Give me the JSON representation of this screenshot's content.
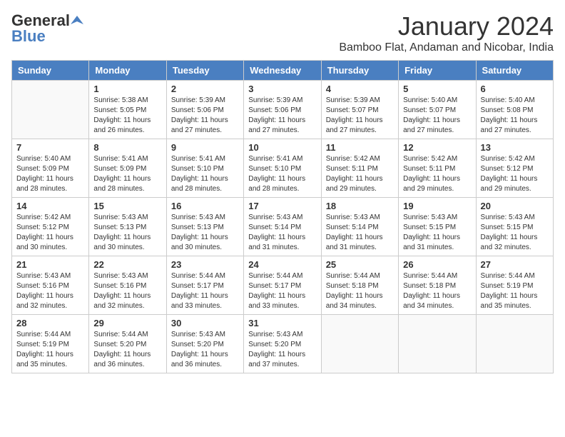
{
  "logo": {
    "general": "General",
    "blue": "Blue"
  },
  "header": {
    "month": "January 2024",
    "location": "Bamboo Flat, Andaman and Nicobar, India"
  },
  "days_of_week": [
    "Sunday",
    "Monday",
    "Tuesday",
    "Wednesday",
    "Thursday",
    "Friday",
    "Saturday"
  ],
  "weeks": [
    [
      {
        "day": "",
        "sunrise": "",
        "sunset": "",
        "daylight": ""
      },
      {
        "day": "1",
        "sunrise": "Sunrise: 5:38 AM",
        "sunset": "Sunset: 5:05 PM",
        "daylight": "Daylight: 11 hours and 26 minutes."
      },
      {
        "day": "2",
        "sunrise": "Sunrise: 5:39 AM",
        "sunset": "Sunset: 5:06 PM",
        "daylight": "Daylight: 11 hours and 27 minutes."
      },
      {
        "day": "3",
        "sunrise": "Sunrise: 5:39 AM",
        "sunset": "Sunset: 5:06 PM",
        "daylight": "Daylight: 11 hours and 27 minutes."
      },
      {
        "day": "4",
        "sunrise": "Sunrise: 5:39 AM",
        "sunset": "Sunset: 5:07 PM",
        "daylight": "Daylight: 11 hours and 27 minutes."
      },
      {
        "day": "5",
        "sunrise": "Sunrise: 5:40 AM",
        "sunset": "Sunset: 5:07 PM",
        "daylight": "Daylight: 11 hours and 27 minutes."
      },
      {
        "day": "6",
        "sunrise": "Sunrise: 5:40 AM",
        "sunset": "Sunset: 5:08 PM",
        "daylight": "Daylight: 11 hours and 27 minutes."
      }
    ],
    [
      {
        "day": "7",
        "sunrise": "Sunrise: 5:40 AM",
        "sunset": "Sunset: 5:09 PM",
        "daylight": "Daylight: 11 hours and 28 minutes."
      },
      {
        "day": "8",
        "sunrise": "Sunrise: 5:41 AM",
        "sunset": "Sunset: 5:09 PM",
        "daylight": "Daylight: 11 hours and 28 minutes."
      },
      {
        "day": "9",
        "sunrise": "Sunrise: 5:41 AM",
        "sunset": "Sunset: 5:10 PM",
        "daylight": "Daylight: 11 hours and 28 minutes."
      },
      {
        "day": "10",
        "sunrise": "Sunrise: 5:41 AM",
        "sunset": "Sunset: 5:10 PM",
        "daylight": "Daylight: 11 hours and 28 minutes."
      },
      {
        "day": "11",
        "sunrise": "Sunrise: 5:42 AM",
        "sunset": "Sunset: 5:11 PM",
        "daylight": "Daylight: 11 hours and 29 minutes."
      },
      {
        "day": "12",
        "sunrise": "Sunrise: 5:42 AM",
        "sunset": "Sunset: 5:11 PM",
        "daylight": "Daylight: 11 hours and 29 minutes."
      },
      {
        "day": "13",
        "sunrise": "Sunrise: 5:42 AM",
        "sunset": "Sunset: 5:12 PM",
        "daylight": "Daylight: 11 hours and 29 minutes."
      }
    ],
    [
      {
        "day": "14",
        "sunrise": "Sunrise: 5:42 AM",
        "sunset": "Sunset: 5:12 PM",
        "daylight": "Daylight: 11 hours and 30 minutes."
      },
      {
        "day": "15",
        "sunrise": "Sunrise: 5:43 AM",
        "sunset": "Sunset: 5:13 PM",
        "daylight": "Daylight: 11 hours and 30 minutes."
      },
      {
        "day": "16",
        "sunrise": "Sunrise: 5:43 AM",
        "sunset": "Sunset: 5:13 PM",
        "daylight": "Daylight: 11 hours and 30 minutes."
      },
      {
        "day": "17",
        "sunrise": "Sunrise: 5:43 AM",
        "sunset": "Sunset: 5:14 PM",
        "daylight": "Daylight: 11 hours and 31 minutes."
      },
      {
        "day": "18",
        "sunrise": "Sunrise: 5:43 AM",
        "sunset": "Sunset: 5:14 PM",
        "daylight": "Daylight: 11 hours and 31 minutes."
      },
      {
        "day": "19",
        "sunrise": "Sunrise: 5:43 AM",
        "sunset": "Sunset: 5:15 PM",
        "daylight": "Daylight: 11 hours and 31 minutes."
      },
      {
        "day": "20",
        "sunrise": "Sunrise: 5:43 AM",
        "sunset": "Sunset: 5:15 PM",
        "daylight": "Daylight: 11 hours and 32 minutes."
      }
    ],
    [
      {
        "day": "21",
        "sunrise": "Sunrise: 5:43 AM",
        "sunset": "Sunset: 5:16 PM",
        "daylight": "Daylight: 11 hours and 32 minutes."
      },
      {
        "day": "22",
        "sunrise": "Sunrise: 5:43 AM",
        "sunset": "Sunset: 5:16 PM",
        "daylight": "Daylight: 11 hours and 32 minutes."
      },
      {
        "day": "23",
        "sunrise": "Sunrise: 5:44 AM",
        "sunset": "Sunset: 5:17 PM",
        "daylight": "Daylight: 11 hours and 33 minutes."
      },
      {
        "day": "24",
        "sunrise": "Sunrise: 5:44 AM",
        "sunset": "Sunset: 5:17 PM",
        "daylight": "Daylight: 11 hours and 33 minutes."
      },
      {
        "day": "25",
        "sunrise": "Sunrise: 5:44 AM",
        "sunset": "Sunset: 5:18 PM",
        "daylight": "Daylight: 11 hours and 34 minutes."
      },
      {
        "day": "26",
        "sunrise": "Sunrise: 5:44 AM",
        "sunset": "Sunset: 5:18 PM",
        "daylight": "Daylight: 11 hours and 34 minutes."
      },
      {
        "day": "27",
        "sunrise": "Sunrise: 5:44 AM",
        "sunset": "Sunset: 5:19 PM",
        "daylight": "Daylight: 11 hours and 35 minutes."
      }
    ],
    [
      {
        "day": "28",
        "sunrise": "Sunrise: 5:44 AM",
        "sunset": "Sunset: 5:19 PM",
        "daylight": "Daylight: 11 hours and 35 minutes."
      },
      {
        "day": "29",
        "sunrise": "Sunrise: 5:44 AM",
        "sunset": "Sunset: 5:20 PM",
        "daylight": "Daylight: 11 hours and 36 minutes."
      },
      {
        "day": "30",
        "sunrise": "Sunrise: 5:43 AM",
        "sunset": "Sunset: 5:20 PM",
        "daylight": "Daylight: 11 hours and 36 minutes."
      },
      {
        "day": "31",
        "sunrise": "Sunrise: 5:43 AM",
        "sunset": "Sunset: 5:20 PM",
        "daylight": "Daylight: 11 hours and 37 minutes."
      },
      {
        "day": "",
        "sunrise": "",
        "sunset": "",
        "daylight": ""
      },
      {
        "day": "",
        "sunrise": "",
        "sunset": "",
        "daylight": ""
      },
      {
        "day": "",
        "sunrise": "",
        "sunset": "",
        "daylight": ""
      }
    ]
  ]
}
